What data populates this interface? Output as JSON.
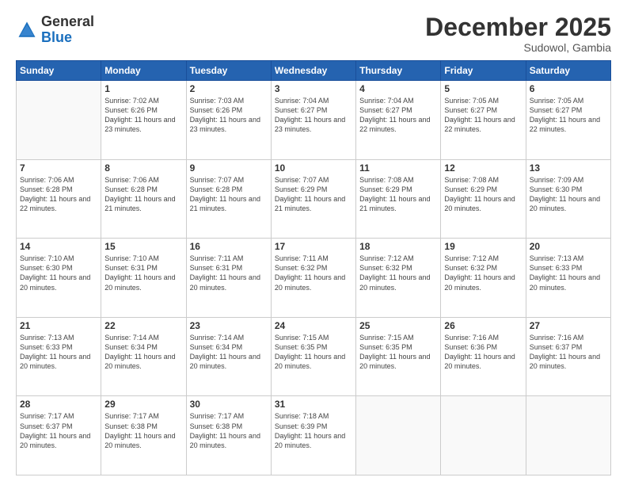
{
  "header": {
    "logo_general": "General",
    "logo_blue": "Blue",
    "month": "December 2025",
    "location": "Sudowol, Gambia"
  },
  "days_of_week": [
    "Sunday",
    "Monday",
    "Tuesday",
    "Wednesday",
    "Thursday",
    "Friday",
    "Saturday"
  ],
  "weeks": [
    [
      {
        "num": "",
        "sunrise": "",
        "sunset": "",
        "daylight": ""
      },
      {
        "num": "1",
        "sunrise": "7:02 AM",
        "sunset": "6:26 PM",
        "daylight": "11 hours and 23 minutes."
      },
      {
        "num": "2",
        "sunrise": "7:03 AM",
        "sunset": "6:26 PM",
        "daylight": "11 hours and 23 minutes."
      },
      {
        "num": "3",
        "sunrise": "7:04 AM",
        "sunset": "6:27 PM",
        "daylight": "11 hours and 23 minutes."
      },
      {
        "num": "4",
        "sunrise": "7:04 AM",
        "sunset": "6:27 PM",
        "daylight": "11 hours and 22 minutes."
      },
      {
        "num": "5",
        "sunrise": "7:05 AM",
        "sunset": "6:27 PM",
        "daylight": "11 hours and 22 minutes."
      },
      {
        "num": "6",
        "sunrise": "7:05 AM",
        "sunset": "6:27 PM",
        "daylight": "11 hours and 22 minutes."
      }
    ],
    [
      {
        "num": "7",
        "sunrise": "7:06 AM",
        "sunset": "6:28 PM",
        "daylight": "11 hours and 22 minutes."
      },
      {
        "num": "8",
        "sunrise": "7:06 AM",
        "sunset": "6:28 PM",
        "daylight": "11 hours and 21 minutes."
      },
      {
        "num": "9",
        "sunrise": "7:07 AM",
        "sunset": "6:28 PM",
        "daylight": "11 hours and 21 minutes."
      },
      {
        "num": "10",
        "sunrise": "7:07 AM",
        "sunset": "6:29 PM",
        "daylight": "11 hours and 21 minutes."
      },
      {
        "num": "11",
        "sunrise": "7:08 AM",
        "sunset": "6:29 PM",
        "daylight": "11 hours and 21 minutes."
      },
      {
        "num": "12",
        "sunrise": "7:08 AM",
        "sunset": "6:29 PM",
        "daylight": "11 hours and 20 minutes."
      },
      {
        "num": "13",
        "sunrise": "7:09 AM",
        "sunset": "6:30 PM",
        "daylight": "11 hours and 20 minutes."
      }
    ],
    [
      {
        "num": "14",
        "sunrise": "7:10 AM",
        "sunset": "6:30 PM",
        "daylight": "11 hours and 20 minutes."
      },
      {
        "num": "15",
        "sunrise": "7:10 AM",
        "sunset": "6:31 PM",
        "daylight": "11 hours and 20 minutes."
      },
      {
        "num": "16",
        "sunrise": "7:11 AM",
        "sunset": "6:31 PM",
        "daylight": "11 hours and 20 minutes."
      },
      {
        "num": "17",
        "sunrise": "7:11 AM",
        "sunset": "6:32 PM",
        "daylight": "11 hours and 20 minutes."
      },
      {
        "num": "18",
        "sunrise": "7:12 AM",
        "sunset": "6:32 PM",
        "daylight": "11 hours and 20 minutes."
      },
      {
        "num": "19",
        "sunrise": "7:12 AM",
        "sunset": "6:32 PM",
        "daylight": "11 hours and 20 minutes."
      },
      {
        "num": "20",
        "sunrise": "7:13 AM",
        "sunset": "6:33 PM",
        "daylight": "11 hours and 20 minutes."
      }
    ],
    [
      {
        "num": "21",
        "sunrise": "7:13 AM",
        "sunset": "6:33 PM",
        "daylight": "11 hours and 20 minutes."
      },
      {
        "num": "22",
        "sunrise": "7:14 AM",
        "sunset": "6:34 PM",
        "daylight": "11 hours and 20 minutes."
      },
      {
        "num": "23",
        "sunrise": "7:14 AM",
        "sunset": "6:34 PM",
        "daylight": "11 hours and 20 minutes."
      },
      {
        "num": "24",
        "sunrise": "7:15 AM",
        "sunset": "6:35 PM",
        "daylight": "11 hours and 20 minutes."
      },
      {
        "num": "25",
        "sunrise": "7:15 AM",
        "sunset": "6:35 PM",
        "daylight": "11 hours and 20 minutes."
      },
      {
        "num": "26",
        "sunrise": "7:16 AM",
        "sunset": "6:36 PM",
        "daylight": "11 hours and 20 minutes."
      },
      {
        "num": "27",
        "sunrise": "7:16 AM",
        "sunset": "6:37 PM",
        "daylight": "11 hours and 20 minutes."
      }
    ],
    [
      {
        "num": "28",
        "sunrise": "7:17 AM",
        "sunset": "6:37 PM",
        "daylight": "11 hours and 20 minutes."
      },
      {
        "num": "29",
        "sunrise": "7:17 AM",
        "sunset": "6:38 PM",
        "daylight": "11 hours and 20 minutes."
      },
      {
        "num": "30",
        "sunrise": "7:17 AM",
        "sunset": "6:38 PM",
        "daylight": "11 hours and 20 minutes."
      },
      {
        "num": "31",
        "sunrise": "7:18 AM",
        "sunset": "6:39 PM",
        "daylight": "11 hours and 20 minutes."
      },
      {
        "num": "",
        "sunrise": "",
        "sunset": "",
        "daylight": ""
      },
      {
        "num": "",
        "sunrise": "",
        "sunset": "",
        "daylight": ""
      },
      {
        "num": "",
        "sunrise": "",
        "sunset": "",
        "daylight": ""
      }
    ]
  ]
}
